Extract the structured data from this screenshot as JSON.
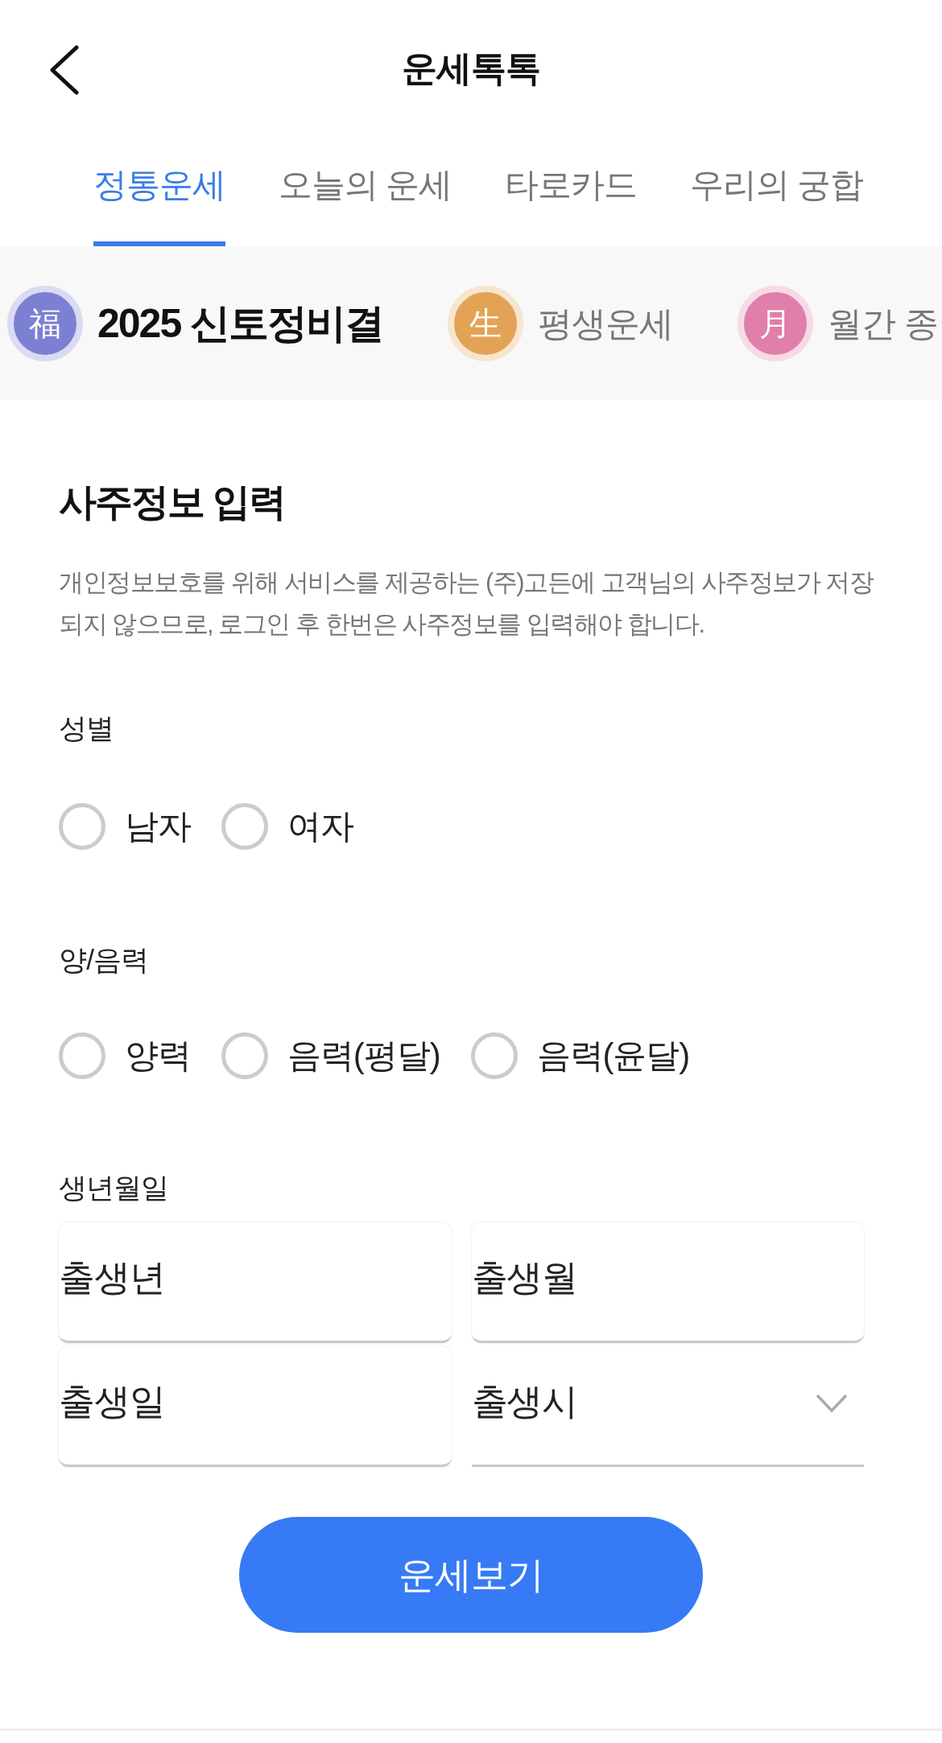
{
  "header": {
    "title": "운세톡톡"
  },
  "tabs": [
    {
      "label": "정통운세",
      "selected": true
    },
    {
      "label": "오늘의 운세",
      "selected": false
    },
    {
      "label": "타로카드",
      "selected": false
    },
    {
      "label": "우리의 궁합",
      "selected": false
    }
  ],
  "categories": [
    {
      "symbol": "福",
      "label": "2025 신토정비결",
      "color": "#7b80d2",
      "selected": true
    },
    {
      "symbol": "生",
      "label": "평생운세",
      "color": "#e3a356",
      "selected": false
    },
    {
      "symbol": "月",
      "label": "월간 종",
      "color": "#e07fa9",
      "selected": false
    }
  ],
  "form": {
    "title": "사주정보 입력",
    "notice": "개인정보보호를 위해 서비스를 제공하는 (주)고든에 고객님의 사주정보가 저장되지 않으므로, 로그인 후 한번은 사주정보를 입력해야 합니다.",
    "gender": {
      "label": "성별",
      "options": [
        {
          "label": "남자",
          "selected": false
        },
        {
          "label": "여자",
          "selected": false
        }
      ]
    },
    "calendar": {
      "label": "양/음력",
      "options": [
        {
          "label": "양력",
          "selected": false
        },
        {
          "label": "음력(평달)",
          "selected": false
        },
        {
          "label": "음력(윤달)",
          "selected": false
        }
      ]
    },
    "birth": {
      "label": "생년월일",
      "fields": [
        {
          "kind": "input",
          "placeholder": "출생년"
        },
        {
          "kind": "input",
          "placeholder": "출생월"
        },
        {
          "kind": "input",
          "placeholder": "출생일"
        },
        {
          "kind": "select",
          "placeholder": "출생시"
        }
      ]
    },
    "submit": "운세보기"
  }
}
